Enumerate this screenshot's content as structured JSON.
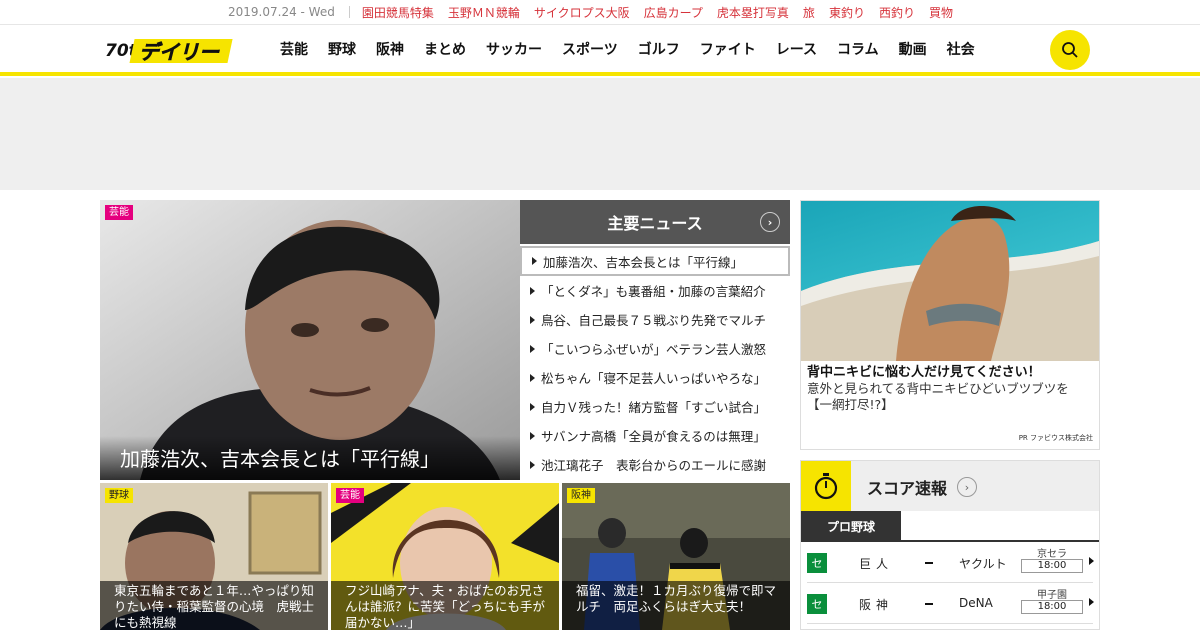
{
  "topbar": {
    "date": "2019.07.24 - Wed",
    "links": [
      "園田競馬特集",
      "玉野ＭＮ競輪",
      "サイクロプス大阪",
      "広島カープ",
      "虎本塁打写真",
      "旅",
      "東釣り",
      "西釣り",
      "買物"
    ]
  },
  "header": {
    "logo_text": "デイリー",
    "logo_badge": "70th",
    "nav": [
      "芸能",
      "野球",
      "阪神",
      "まとめ",
      "サッカー",
      "スポーツ",
      "ゴルフ",
      "ファイト",
      "レース",
      "コラム",
      "動画",
      "社会"
    ],
    "search_icon": "search-icon"
  },
  "hero": {
    "category": "芸能",
    "title": "加藤浩次、吉本会長とは「平行線」"
  },
  "main_news": {
    "title": "主要ニュース",
    "items": [
      "加藤浩次、吉本会長とは「平行線」",
      "「とくダネ」も裏番組・加藤の言葉紹介",
      "鳥谷、自己最長７５戦ぶり先発でマルチ",
      "「こいつらふぜいが」ベテラン芸人激怒",
      "松ちゃん「寝不足芸人いっぱいやろな」",
      "自力Ｖ残った！緒方監督「すごい試合」",
      "サバンナ高橋「全員が食えるのは無理」",
      "池江璃花子　表彰台からのエールに感謝"
    ]
  },
  "thumbs": [
    {
      "category": "野球",
      "caption": "東京五輪まであと１年…やっぱり知りたい侍・稲葉監督の心境　虎戦士にも熱視線"
    },
    {
      "category": "芸能",
      "caption": "フジ山崎アナ、夫・おばたのお兄さんは誰派？に苦笑「どっちにも手が届かない…」"
    },
    {
      "category": "阪神",
      "caption": "福留、激走！１カ月ぶり復帰で即マルチ　両足ふくらはぎ大丈夫！"
    }
  ],
  "pr": {
    "title": "背中ニキビに悩む人だけ見てください！",
    "description": "意外と見られてる背中ニキビひどいブツブツを【一網打尽!?】",
    "sponsor": "PR ファビウス株式会社"
  },
  "score": {
    "title": "スコア速報",
    "tab": "プロ野球",
    "games": [
      {
        "league": "セ",
        "home": "巨人",
        "away": "ヤクルト",
        "venue": "京セラ",
        "time": "18:00"
      },
      {
        "league": "セ",
        "home": "阪神",
        "away": "DeNA",
        "venue": "甲子園",
        "time": "18:00"
      }
    ]
  },
  "colors": {
    "accent_yellow": "#f6e400",
    "link_red": "#d6333b",
    "tag_pink": "#e5007f",
    "league_green": "#0a8f3c"
  }
}
